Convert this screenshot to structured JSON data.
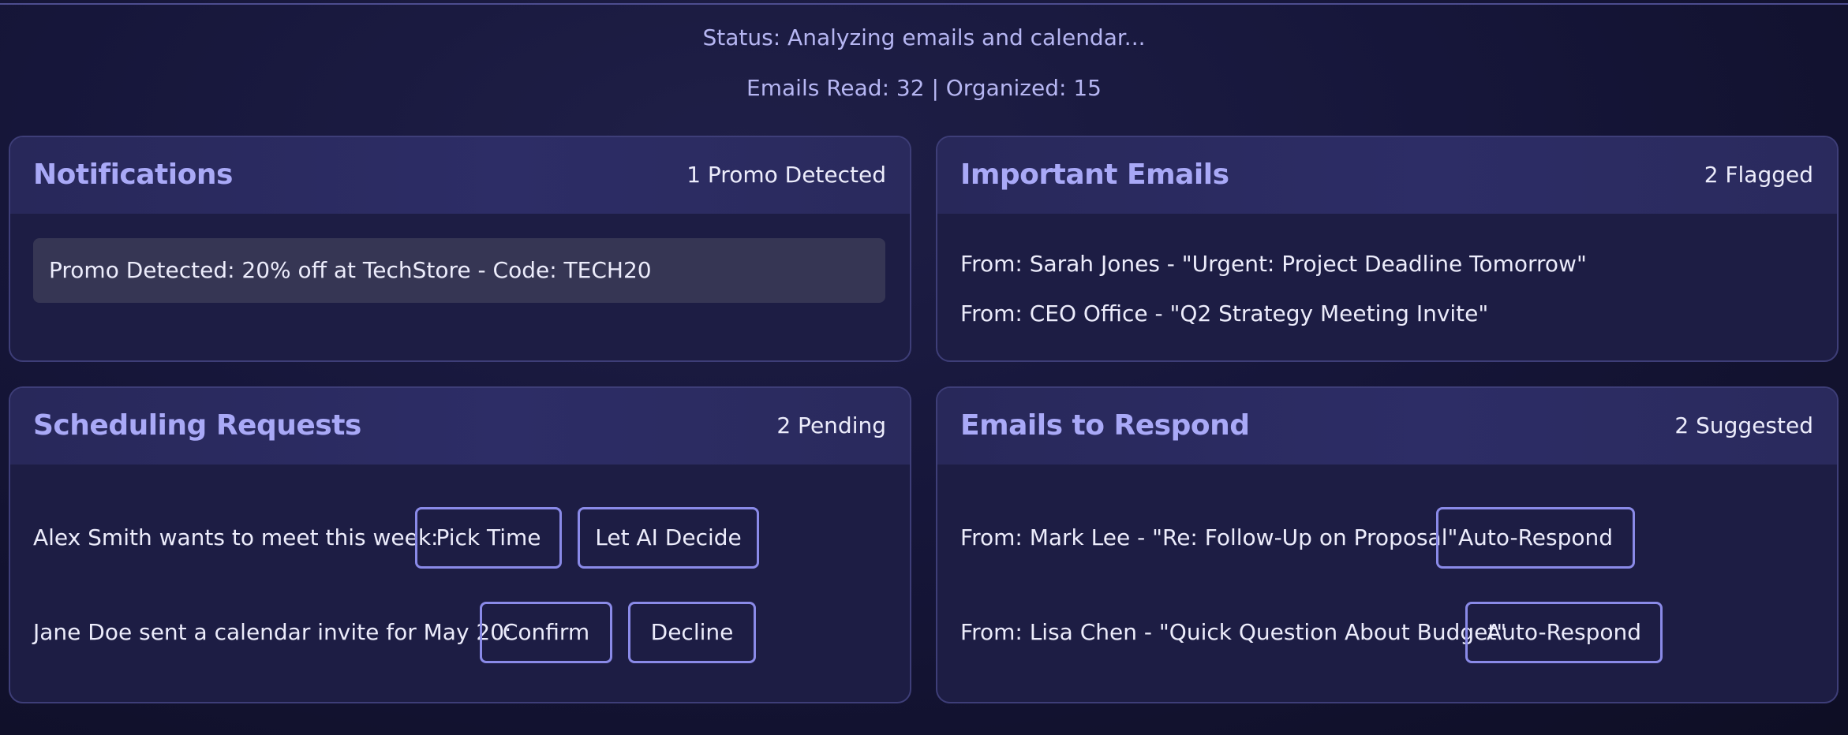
{
  "status": {
    "line": "Status: Analyzing emails and calendar...",
    "counts": "Emails Read: 32 | Organized: 15"
  },
  "notifications": {
    "title": "Notifications",
    "badge": "1 Promo Detected",
    "promo": "Promo Detected: 20% off at TechStore - Code: TECH20"
  },
  "important": {
    "title": "Important Emails",
    "badge": "2 Flagged",
    "emails": [
      "From: Sarah Jones - \"Urgent: Project Deadline Tomorrow\"",
      "From: CEO Office - \"Q2 Strategy Meeting Invite\""
    ]
  },
  "scheduling": {
    "title": "Scheduling Requests",
    "badge": "2 Pending",
    "requests": [
      {
        "text": "Alex Smith wants to meet this week:",
        "actions": [
          "Pick Time",
          "Let AI Decide"
        ]
      },
      {
        "text": "Jane Doe sent a calendar invite for May 20:",
        "actions": [
          "Confirm",
          "Decline"
        ]
      }
    ]
  },
  "respond": {
    "title": "Emails to Respond",
    "badge": "2 Suggested",
    "emails": [
      {
        "text": "From: Mark Lee - \"Re: Follow-Up on Proposal\"",
        "action": "Auto-Respond"
      },
      {
        "text": "From: Lisa Chen - \"Quick Question About Budget\"",
        "action": "Auto-Respond"
      }
    ]
  },
  "colors": {
    "accent": "#a9a9f7",
    "button_border": "#8a8ae8",
    "background": "#16163a"
  }
}
